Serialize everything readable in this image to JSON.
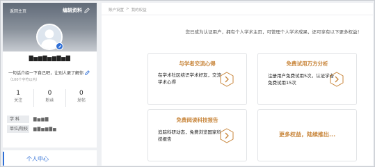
{
  "sidebar": {
    "back_home": "返回主页",
    "edit_profile": "编辑资料",
    "username": "▇▅▆▇▅▆▇▅▇",
    "bio": "一句话介绍一下自己吧，让别人更了解你",
    "bio_count": "（100个字符以内）",
    "stats": [
      {
        "value": "1",
        "label": "关注"
      },
      {
        "value": "0",
        "label": "粉丝"
      },
      {
        "value": "0",
        "label": "发帖"
      }
    ],
    "subject_label": "学 科",
    "subject_value": "▇▅▆▇",
    "unit_label": "单位/院校",
    "unit_value": "▆▇▅▆▇▅",
    "nav_personal": "个人中心"
  },
  "main": {
    "breadcrumb": [
      "账户设置",
      ">",
      "我的权益"
    ],
    "intro": "您已成为认证用户，拥有个人学术主页，可管理个人学术成果，还可享有以下更多权益！",
    "cards": [
      {
        "title": "与学者交流心得",
        "desc": "在学术社区结识学术好友，交流学术心得"
      },
      {
        "title": "免费试用万方分析",
        "desc": "注册用户免费试用5次，认证学者免费试用15次"
      },
      {
        "title": "免费阅读科技报告",
        "desc": "追踪科研动态，免费浏览国家科技报告"
      }
    ],
    "more_text": "更多权益，陆续推出..."
  },
  "colors": {
    "accent_gold": "#c8853a",
    "accent_blue": "#2f6fd6"
  }
}
